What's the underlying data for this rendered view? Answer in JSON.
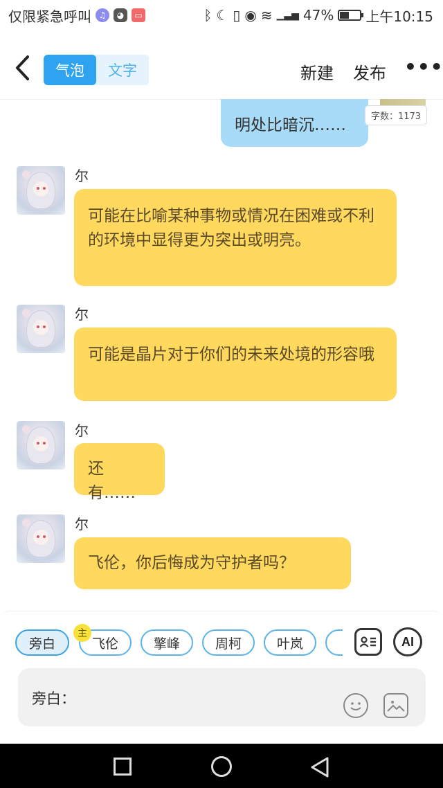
{
  "status_bar": {
    "left_text": "仅限紧急呼叫",
    "battery": "47%",
    "time": "上午10:15",
    "battery_level": 0.47
  },
  "top_bar": {
    "tabs": [
      {
        "label": "气泡",
        "active": true
      },
      {
        "label": "文字",
        "active": false
      }
    ],
    "new_label": "新建",
    "publish_label": "发布",
    "more_label": "•••"
  },
  "chat": {
    "self_message": "明处比暗沉……",
    "word_count": "字数：1173",
    "messages": [
      {
        "name": "尔",
        "text": "可能在比喻某种事物或情况在困难或不利的环境中显得更为突出或明亮。"
      },
      {
        "name": "尔",
        "text": "可能是晶片对于你们的未来处境的形容哦"
      },
      {
        "name": "尔",
        "text": "还有……"
      },
      {
        "name": "尔",
        "text": "飞伦，你后悔成为守护者吗？"
      }
    ]
  },
  "composer": {
    "characters": [
      {
        "label": "旁白",
        "selected": true
      },
      {
        "label": "飞伦",
        "selected": false
      },
      {
        "label": "擎峰",
        "selected": false
      },
      {
        "label": "周柯",
        "selected": false
      },
      {
        "label": "叶岚",
        "selected": false
      }
    ],
    "host_badge": "主",
    "ai_label": "AI",
    "input_label": "旁白："
  },
  "colors": {
    "accent": "#2ea3ef",
    "other_bubble": "#ffd85e",
    "self_bubble": "#a8dbf7"
  }
}
